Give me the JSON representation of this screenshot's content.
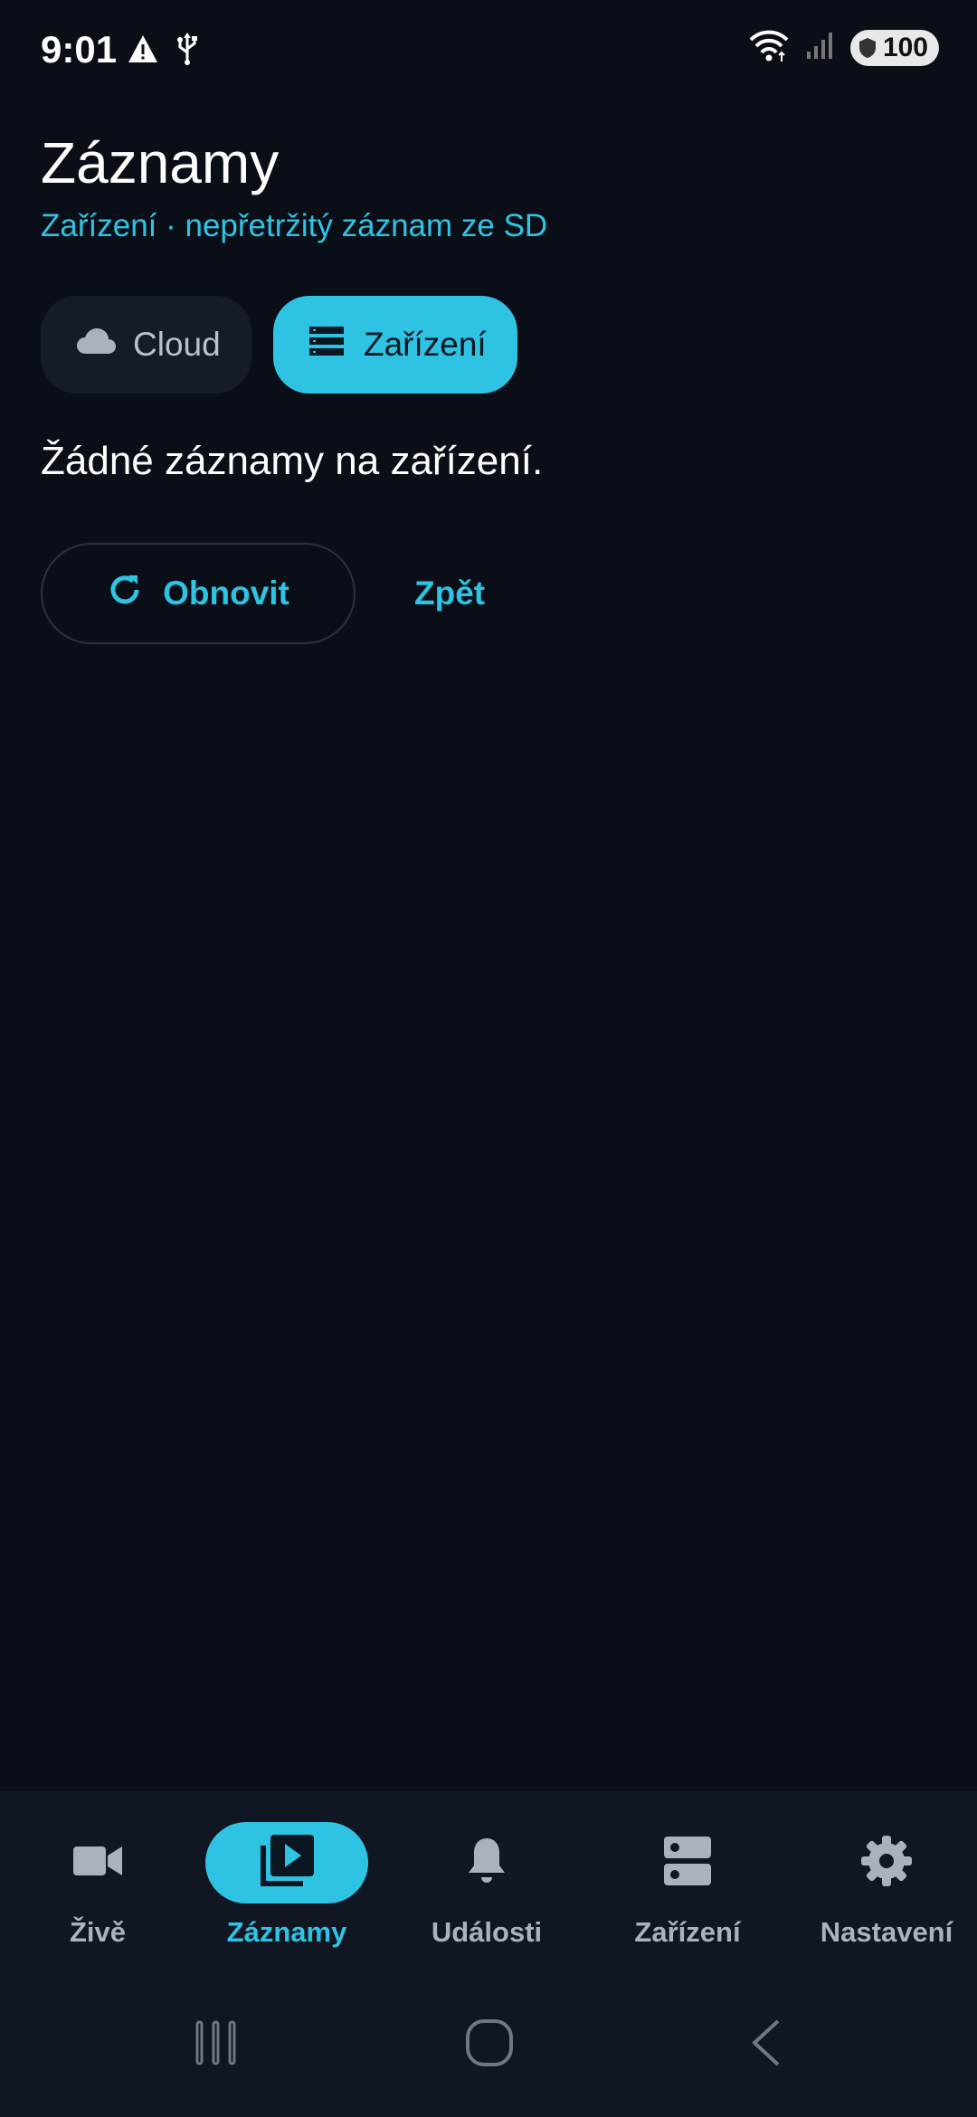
{
  "status_bar": {
    "time": "9:01",
    "battery_level": "100",
    "icons": [
      "warning-icon",
      "usb-icon",
      "wifi-icon",
      "signal-icon",
      "battery-icon"
    ]
  },
  "header": {
    "title": "Záznamy",
    "subtitle": "Zařízení · nepřetržitý záznam ze SD"
  },
  "source_toggle": {
    "cloud_label": "Cloud",
    "device_label": "Zařízení",
    "selected": "Zařízení"
  },
  "content": {
    "empty_message": "Žádné záznamy na zařízení.",
    "refresh_label": "Obnovit",
    "back_label": "Zpět"
  },
  "bottom_nav": {
    "items": [
      {
        "label": "Živě",
        "icon": "video-camera-icon"
      },
      {
        "label": "Záznamy",
        "icon": "video-library-icon"
      },
      {
        "label": "Události",
        "icon": "bell-icon"
      },
      {
        "label": "Zařízení",
        "icon": "storage-icon"
      },
      {
        "label": "Nastavení",
        "icon": "gear-icon"
      }
    ],
    "active": "Záznamy"
  },
  "colors": {
    "background": "#0a0f17",
    "accent": "#2fc3e3",
    "nav_background": "#101722",
    "inactive_text": "#a9b2bd"
  }
}
